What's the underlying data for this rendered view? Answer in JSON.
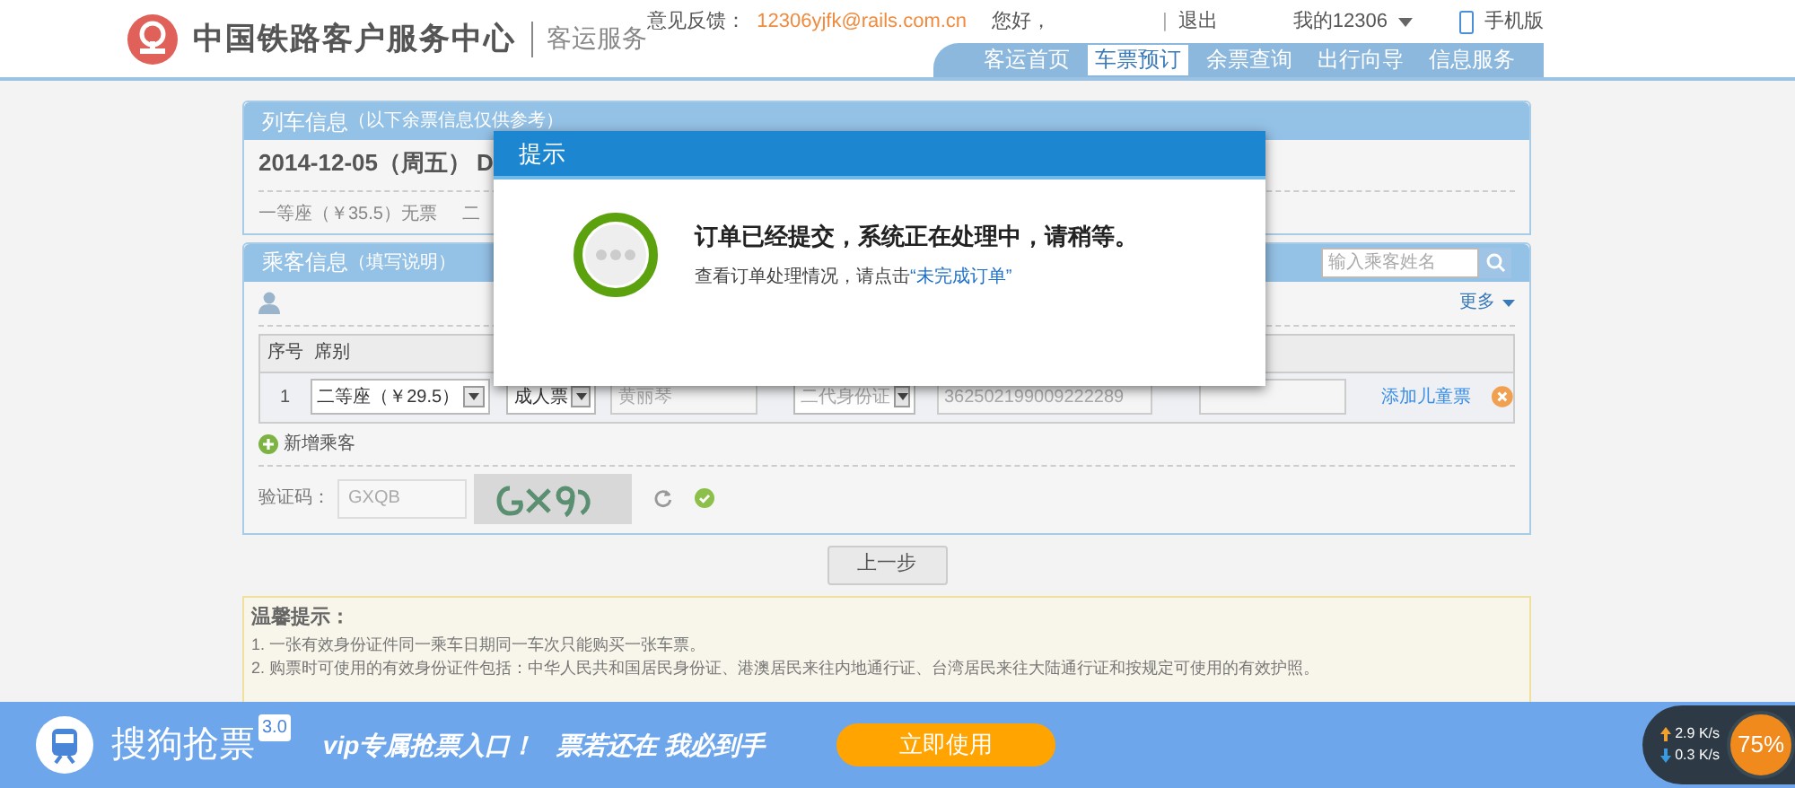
{
  "header": {
    "logo_title": "中国铁路客户服务中心",
    "logo_subtitle": "客运服务",
    "feedback_label": "意见反馈：",
    "feedback_email": "12306yjfk@rails.com.cn",
    "greeting": "您好，",
    "separator": "|",
    "logout": "退出",
    "my_account": "我的12306",
    "mobile": "手机版"
  },
  "nav": [
    {
      "label": "客运首页",
      "selected": false
    },
    {
      "label": "车票预订",
      "selected": true
    },
    {
      "label": "余票查询",
      "selected": false
    },
    {
      "label": "出行向导",
      "selected": false
    },
    {
      "label": "信息服务",
      "selected": false
    }
  ],
  "train_info": {
    "title": "列车信息",
    "note": "（以下余票信息仅供参考）",
    "date": "2014-12-05（周五）",
    "train_code": "D",
    "seats": [
      "一等座（￥35.5）无票",
      "二"
    ]
  },
  "passengers": {
    "title": "乘客信息",
    "note": "（填写说明）",
    "search_placeholder": "输入乘客姓名",
    "more": "更多",
    "columns": [
      "序号",
      "席别"
    ],
    "rows": [
      {
        "index": "1",
        "seat": "二等座（￥29.5）",
        "ticket_type": "成人票",
        "name": "黄丽琴",
        "id_type": "二代身份证",
        "id_number": "362502199009222289",
        "add_child": "添加儿童票"
      }
    ],
    "add_passenger": "新增乘客",
    "captcha_label": "验证码：",
    "captcha_value": "GXQB",
    "captcha_verified": true
  },
  "back_button": "上一步",
  "tips": {
    "title": "温馨提示：",
    "items": [
      "1. 一张有效身份证件同一乘车日期同一车次只能购买一张车票。",
      "2. 购票时可使用的有效身份证件包括：中华人民共和国居民身份证、港澳居民来往内地通行证、台湾居民来往大陆通行证和按规定可使用的有效护照。"
    ]
  },
  "dialog": {
    "title": "提示",
    "message": "订单已经提交，系统正在处理中，请稍等。",
    "hint": "查看订单处理情况，请点击",
    "link": "“未完成订单”"
  },
  "banner": {
    "app_name": "搜狗抢票",
    "version": "3.0",
    "slogan_1": "vip专属抢票入口！",
    "slogan_2": "票若还在 我必到手",
    "cta": "立即使用"
  },
  "speed_widget": {
    "upload": "2.9 K/s",
    "download": "0.3 K/s",
    "usage": "75%"
  }
}
